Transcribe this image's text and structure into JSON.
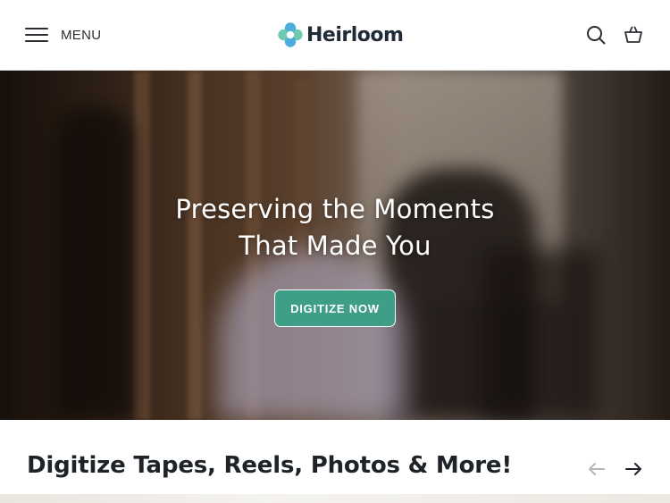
{
  "header": {
    "menu_label": "MENU",
    "logo_text": "Heirloom",
    "icons": [
      "hamburger-icon",
      "search-icon",
      "cart-icon"
    ]
  },
  "hero": {
    "title_line1": "Preserving the Moments",
    "title_line2": "That Made You",
    "cta_label": "DIGITIZE NOW"
  },
  "section": {
    "title": "Digitize Tapes, Reels, Photos & More!"
  },
  "colors": {
    "accent": "#3f9e87",
    "text": "#1e2328",
    "logo_blue": "#3ba3d8",
    "logo_green": "#5fc4a6"
  }
}
